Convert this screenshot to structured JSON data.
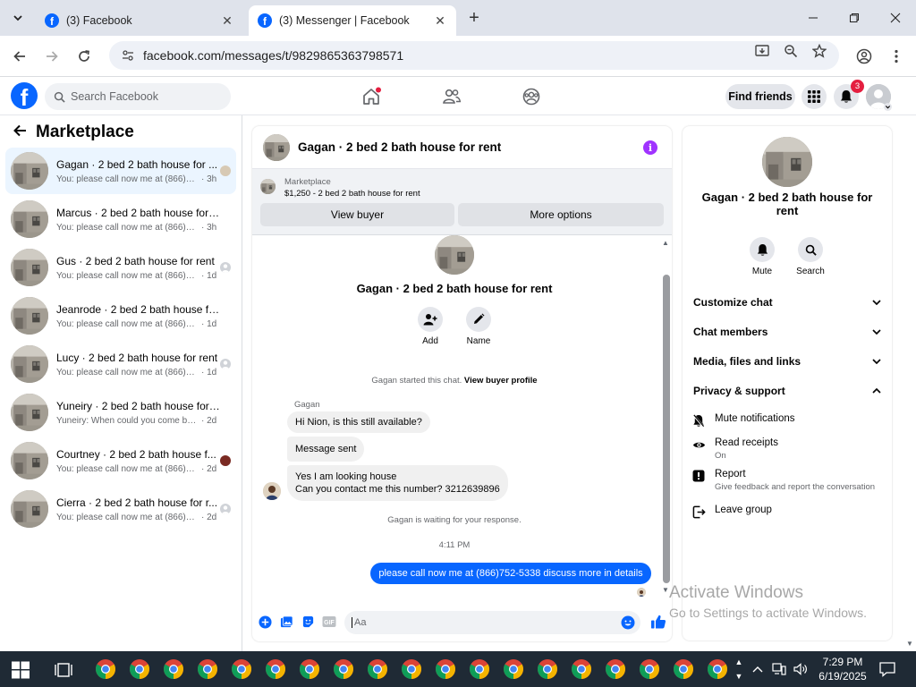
{
  "browser": {
    "tabs": [
      {
        "title": "(3) Facebook",
        "active": false
      },
      {
        "title": "(3) Messenger | Facebook",
        "active": true
      }
    ],
    "url": "facebook.com/messages/t/9829865363798571"
  },
  "header": {
    "search_placeholder": "Search Facebook",
    "find_friends": "Find friends",
    "notifications_count": "3"
  },
  "sidebar": {
    "title": "Marketplace",
    "conversations": [
      {
        "name": "Gagan · 2 bed 2 bath house for ...",
        "preview": "You: please call now me at (866)75...",
        "time": "· 3h",
        "active": true
      },
      {
        "name": "Marcus · 2 bed 2 bath house for rent",
        "preview": "You: please call now me at (866)752-5...",
        "time": "· 3h",
        "active": false
      },
      {
        "name": "Gus · 2 bed 2 bath house for rent",
        "preview": "You: please call now me at (866)75...",
        "time": "· 1d",
        "active": false
      },
      {
        "name": "Jeanrode · 2 bed 2 bath house for ...",
        "preview": "You: please call now me at (866)752-5...",
        "time": "· 1d",
        "active": false
      },
      {
        "name": "Lucy · 2 bed 2 bath house for rent",
        "preview": "You: please call now me at (866)75...",
        "time": "· 1d",
        "active": false
      },
      {
        "name": "Yuneiry · 2 bed 2 bath house for re...",
        "preview": "Yuneiry: When could you come by to ...",
        "time": "· 2d",
        "active": false
      },
      {
        "name": "Courtney · 2 bed 2 bath house f...",
        "preview": "You: please call now me at (866)75...",
        "time": "· 2d",
        "active": false
      },
      {
        "name": "Cierra · 2 bed 2 bath house for r...",
        "preview": "You: please call now me at (866)75...",
        "time": "· 2d",
        "active": false
      }
    ]
  },
  "chat": {
    "title": "Gagan · 2 bed 2 bath house for rent",
    "marketplace_label": "Marketplace",
    "listing": "$1,250 - 2 bed 2 bath house for rent",
    "view_buyer": "View buyer",
    "more_options": "More options",
    "intro_title": "Gagan · 2 bed 2 bath house for rent",
    "add_label": "Add",
    "name_label": "Name",
    "started_text": "Gagan started this chat.",
    "view_profile": "View buyer profile",
    "sender": "Gagan",
    "messages_in": [
      {
        "lines": [
          "Hi Nion, is this still available?"
        ]
      },
      {
        "lines": [
          "Message sent"
        ]
      },
      {
        "lines": [
          "Yes I am looking house",
          "Can you contact me this number? 3212639896"
        ]
      }
    ],
    "waiting": "Gagan is waiting for your response.",
    "time": "4:11 PM",
    "message_out": "please call now me at (866)752-5338 discuss more in details",
    "composer_placeholder": "Aa"
  },
  "info_panel": {
    "title": "Gagan · 2 bed 2 bath house for rent",
    "mute": "Mute",
    "search": "Search",
    "sections": [
      "Customize chat",
      "Chat members",
      "Media, files and links",
      "Privacy & support"
    ],
    "privacy_items": [
      {
        "title": "Mute notifications",
        "subtitle": ""
      },
      {
        "title": "Read receipts",
        "subtitle": "On"
      },
      {
        "title": "Report",
        "subtitle": "Give feedback and report the conversation"
      },
      {
        "title": "Leave group",
        "subtitle": ""
      }
    ]
  },
  "watermark": {
    "line1": "Activate Windows",
    "line2": "Go to Settings to activate Windows."
  },
  "taskbar": {
    "time": "7:29 PM",
    "date": "6/19/2025"
  },
  "colors": {
    "fb_blue": "#0866ff",
    "info_purple": "#a033ff",
    "badge_red": "#e41e3f",
    "taskbar": "#1f2a35"
  }
}
